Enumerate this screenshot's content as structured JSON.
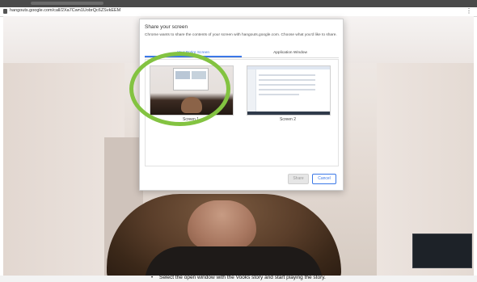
{
  "browser": {
    "url": "hangouts.google.com/call/2Xa7Cwn1UobrQc6ZSvkEEM",
    "menu_glyph": "⋮"
  },
  "dialog": {
    "title": "Share your screen",
    "description": "Chrome wants to share the contents of your screen with hangouts.google.com. Choose what you'd like to share.",
    "tabs": [
      {
        "label": "Your Entire Screen",
        "active": true
      },
      {
        "label": "Application Window",
        "active": false
      }
    ],
    "screens": [
      {
        "label": "Screen 1"
      },
      {
        "label": "Screen 2"
      }
    ],
    "share_label": "Share",
    "cancel_label": "Cancel",
    "highlight_color": "#83c341",
    "accent_color": "#3b78e7"
  },
  "caption": {
    "bullet": "•",
    "text": "Select the open window with the Vooks story and start playing the story."
  }
}
